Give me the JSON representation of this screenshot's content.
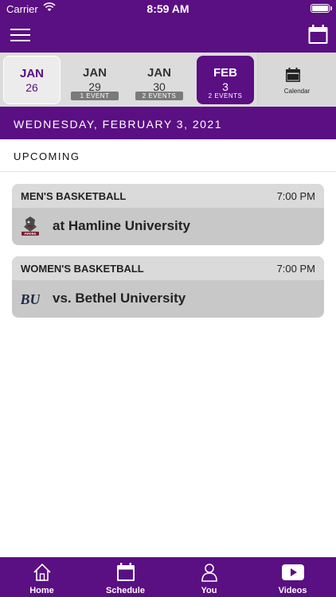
{
  "status_bar": {
    "carrier": "Carrier",
    "time": "8:59 AM"
  },
  "date_strip": {
    "dates": [
      {
        "month": "JAN",
        "day": "26",
        "events": ""
      },
      {
        "month": "JAN",
        "day": "29",
        "events": "1 EVENT"
      },
      {
        "month": "JAN",
        "day": "30",
        "events": "2 EVENTS"
      },
      {
        "month": "FEB",
        "day": "3",
        "events": "2 EVENTS"
      }
    ],
    "calendar_label": "Calendar"
  },
  "selected_date": "WEDNESDAY, FEBRUARY 3, 2021",
  "section_title": "UPCOMING",
  "events": [
    {
      "sport": "MEN'S BASKETBALL",
      "time": "7:00 PM",
      "opponent": "at Hamline University",
      "logo_text": "PIPERS"
    },
    {
      "sport": "WOMEN'S BASKETBALL",
      "time": "7:00 PM",
      "opponent": "vs. Bethel University",
      "logo_text": "BU"
    }
  ],
  "tabs": [
    {
      "label": "Home",
      "icon": "home-icon"
    },
    {
      "label": "Schedule",
      "icon": "calendar-icon"
    },
    {
      "label": "You",
      "icon": "person-icon"
    },
    {
      "label": "Videos",
      "icon": "play-icon"
    }
  ],
  "colors": {
    "brand_purple": "#5a0f82",
    "strip_gray": "#dcdcdc",
    "card_gray": "#c8c8c8",
    "badge_gray": "#7a7a7a"
  }
}
